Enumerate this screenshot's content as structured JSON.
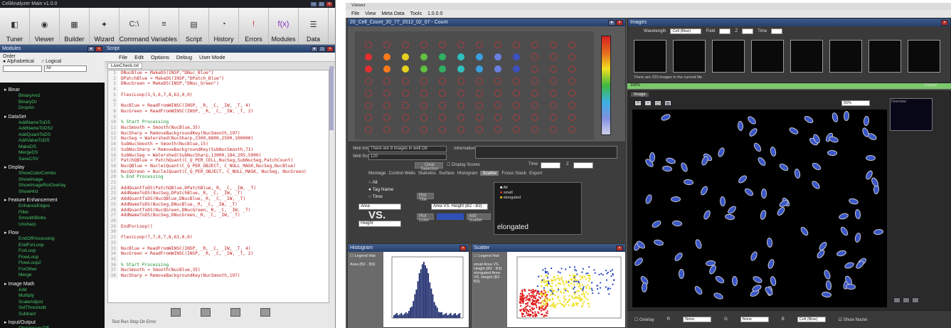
{
  "left_app": {
    "title": "CellAnalyzer  Main  v1.0.0",
    "toolbar": [
      {
        "label": "Tuner",
        "icon": "tuner-icon"
      },
      {
        "label": "Viewer",
        "icon": "eye-icon"
      },
      {
        "label": "Builder",
        "icon": "grid-icon"
      },
      {
        "label": "Wizard",
        "icon": "wand-icon"
      },
      {
        "label": "Command",
        "icon": "command-icon"
      },
      {
        "label": "Variables",
        "icon": "variables-icon"
      },
      {
        "label": "Script",
        "icon": "script-icon"
      },
      {
        "label": "History",
        "icon": "history-icon"
      },
      {
        "label": "Errors",
        "icon": "error-icon"
      },
      {
        "label": "Modules",
        "icon": "function-icon"
      },
      {
        "label": "Data",
        "icon": "data-icon"
      }
    ],
    "modules": {
      "title": "Modules",
      "sort_label": "Order",
      "opt_alpha": "Alphabetical",
      "opt_logical": "Logical",
      "filter_value": "All",
      "categories": [
        {
          "name": "Binar",
          "items": [
            "BinaryAnd",
            "BinaryOr",
            "DropAn"
          ]
        },
        {
          "name": "DataSet",
          "items": [
            "AddNameToDS",
            "AddNameToDS2",
            "AddQuantToDS",
            "AddValueToDS",
            "MakeDS",
            "MergeDS",
            "SaveCSV"
          ]
        },
        {
          "name": "Display",
          "items": [
            "ShowColorCombo",
            "ShowImage",
            "ShowImageRoiOverlay",
            "ShowHist"
          ]
        },
        {
          "name": "Feature Enhancement",
          "items": [
            "EnhanceEdges",
            "Filter",
            "SmoothBlobs",
            "Unsharp"
          ]
        },
        {
          "name": "Flow",
          "items": [
            "EndOfProcessing",
            "EndForLoop",
            "ForLoop",
            "FlowLoop",
            "FlowLoop2",
            "ForOther",
            "Merge"
          ]
        },
        {
          "name": "Image Math",
          "items": [
            "Add",
            "Multiply",
            "ScaleAdjust",
            "SetThreshold",
            "Subtract"
          ]
        },
        {
          "name": "Input/Output",
          "items": [
            "OpenImageTiff",
            "SaveToImageTiff"
          ]
        }
      ]
    },
    "script": {
      "title": "Script",
      "menu": [
        "File",
        "Edit",
        "Options",
        "Debug",
        "User Mode"
      ],
      "tab": "LiveCheck.txt",
      "lines": [
        {
          "n": "1",
          "t": "DNucBlue = MakeDS(INSP,\"DNuc_Blue\")",
          "c": "red"
        },
        {
          "n": "2",
          "t": "DPatchBlue = MakeDS(INSP,\"DPatch_Blue\")",
          "c": "red"
        },
        {
          "n": "3",
          "t": "DNucGreen = MakeDS(INSP,\"DNuc_Green\")",
          "c": "red"
        },
        {
          "n": "4",
          "t": "",
          "c": "blk"
        },
        {
          "n": "5",
          "t": "FlexiLoop(3,5,6,7,8,63,0,0)",
          "c": "red"
        },
        {
          "n": "6",
          "t": "",
          "c": "blk"
        },
        {
          "n": "7",
          "t": "NucBlue = ReadFromWINSC(INSP, _R, _C, _IW, _T, 4)",
          "c": "red"
        },
        {
          "n": "8",
          "t": "NucGreen = ReadFromWINSC(INSP, _R, _C, _IW, _T, 2)",
          "c": "red"
        },
        {
          "n": "9",
          "t": "",
          "c": "blk"
        },
        {
          "n": "10",
          "t": "% Start Processing",
          "c": "green"
        },
        {
          "n": "11",
          "t": "NucSmooth = Smooth(NucBlue,35)",
          "c": "red"
        },
        {
          "n": "12",
          "t": "NucSharp = RemoveBackgroundKey(NucSmooth,197)",
          "c": "red"
        },
        {
          "n": "13",
          "t": "NucSeg = Watershed(NucSharp,2300,8800,2500,100000)",
          "c": "red"
        },
        {
          "n": "14",
          "t": "SubNucSmooth = Smooth(NucBlue,15)",
          "c": "red"
        },
        {
          "n": "15",
          "t": "SubNucSharp = RemoveBackgroundKey(SubNucSmooth,71)",
          "c": "red"
        },
        {
          "n": "16",
          "t": "SubNucSeg = Watershed(SubNucSharp,13000,184,295,5000)",
          "c": "red"
        },
        {
          "n": "17",
          "t": "PatchQBlue = PatchQuant(C_Q_PER_CELL,NucSeg,SubNucSeg,PatchCount)",
          "c": "red"
        },
        {
          "n": "18",
          "t": "NucQBlue = NucleiQuant(C_Q_PER_OBJECT, C_NULL_MASK,NucSeg,NucBlue)",
          "c": "red"
        },
        {
          "n": "19",
          "t": "NucQGreen = NucleiQuant(C_Q_PER_OBJECT, C_NULL_MASK, NucSeg, NucGreen)",
          "c": "red"
        },
        {
          "n": "20",
          "t": "% End Processing",
          "c": "green"
        },
        {
          "n": "21",
          "t": "",
          "c": "blk"
        },
        {
          "n": "22",
          "t": "AddQuantToDS(PatchQBlue,DPatchBlue,_R, _C, _IW, _T)",
          "c": "red"
        },
        {
          "n": "23",
          "t": "AddNameToDS(NucSeg,DPatchBlue,_R, _C, _IW, _T)",
          "c": "red"
        },
        {
          "n": "24",
          "t": "AddQuantToDS(NucQBlue,DNucBlue,_R, _C, _IW, _T)",
          "c": "red"
        },
        {
          "n": "25",
          "t": "AddNameToDS(NucSeg,DNucBlue,_R, _C, _IW, _T)",
          "c": "red"
        },
        {
          "n": "26",
          "t": "AddQuantToDS(NucQGreen,DNucGreen,_R, _C, _IW, _T)",
          "c": "red"
        },
        {
          "n": "27",
          "t": "AddNameToDS(NucSeg,DNucGreen,_R, _C, _IW, _T)",
          "c": "red"
        },
        {
          "n": "28",
          "t": "",
          "c": "blk"
        },
        {
          "n": "29",
          "t": "EndForLoop()",
          "c": "red"
        },
        {
          "n": "30",
          "t": "",
          "c": "blk"
        },
        {
          "n": "31",
          "t": "FlexiLoop(7,7,6,7,8,63,0,0)",
          "c": "red"
        },
        {
          "n": "32",
          "t": "",
          "c": "blk"
        },
        {
          "n": "33",
          "t": "NucBlue = ReadFromWINSC(INSP, _R, _C, _IW, _T, 4)",
          "c": "red"
        },
        {
          "n": "34",
          "t": "NucGreen = ReadFromWINSC(INSP, _R, _C, _IW, _T, 2)",
          "c": "red"
        },
        {
          "n": "35",
          "t": "",
          "c": "blk"
        },
        {
          "n": "36",
          "t": "% Start Processing",
          "c": "green"
        },
        {
          "n": "37",
          "t": "NucSmooth = Smooth(NucBlue,35)",
          "c": "red"
        },
        {
          "n": "38",
          "t": "NucSharp = RemoveBackgroundKey(NucSmooth,197)",
          "c": "red"
        }
      ],
      "footer": "Test Run     Stop On Error"
    }
  },
  "right_app": {
    "title": "Viewer",
    "menu": [
      "File",
      "View",
      "Meta Data",
      "Tools",
      "1.0.0.0"
    ],
    "count_panel": {
      "title": "20_Cell_Count_20_77_2012_02_07 - Count"
    },
    "info": {
      "well_info_label": "Well Info",
      "well_info_value": "There are 9 images in well D8",
      "well_score_label": "Well Score",
      "well_score_value": "120",
      "information_label": "Information",
      "clear_selection": "Clear Selection",
      "display_scores": "Display Scores",
      "time_label": "Time",
      "z_label": "Z",
      "tabs": [
        "Montage",
        "Control Wells",
        "Statistics",
        "Surface",
        "Histogram",
        "Scatter",
        "Focus Stack",
        "Export"
      ],
      "active_tab": "Scatter",
      "radios": [
        "All",
        "Tag Name",
        "Time"
      ],
      "plot_title_btn": "Plot Title",
      "x_select": "Area",
      "y_select": "Height",
      "vs": "VS.",
      "plot_color_btn": "Plot Color",
      "add_scatter_btn": "Add Scatter",
      "plot_name": "Area VS. Height (B2 - B3)",
      "legend_items": [
        "All",
        "small",
        "elongated"
      ],
      "elongated_label": "elongated"
    },
    "histogram": {
      "title": "Histogram",
      "legend": "Legend Hist",
      "side_label": "Area (B2 - B3)"
    },
    "scatter": {
      "title": "Scatter",
      "legend": "Legend Hist",
      "side_label": "small Area VS. Height (B2 - B3) elongated Area VS. Height (B2 - B3)"
    },
    "images_panel": {
      "title": "Images",
      "wavelength_label": "Wavelength",
      "wavelength_value": "Cell (Blue)",
      "field_label": "Field",
      "z_label": "Z",
      "time_label": "Time",
      "caption": "There are 220 images in the current file",
      "cancel": "Cancel",
      "progress_label": "100%",
      "progress": 1.0
    },
    "image_view": {
      "tab": "Image",
      "zoom": "55%",
      "mini_title": "Overview"
    },
    "bottom": {
      "overlay": "Overlay",
      "r_label": "R",
      "g_label": "G",
      "b_label": "B",
      "r_value": "None",
      "g_value": "None",
      "b_value": "Cell (Blue)",
      "show_nuclei": "Show Nuclei"
    }
  }
}
